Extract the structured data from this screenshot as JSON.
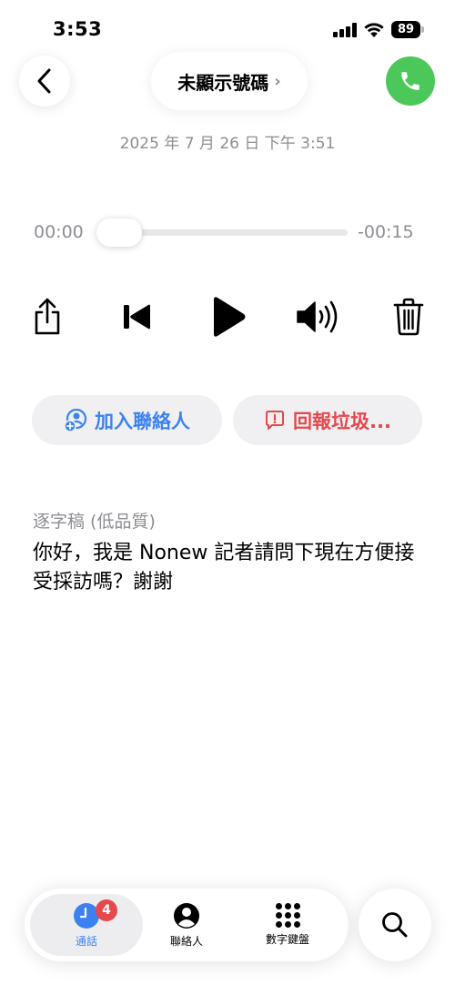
{
  "status_bar": {
    "time": "3:53",
    "battery": "89"
  },
  "header": {
    "caller": "未顯示號碼",
    "caller_chevron": "›",
    "date": "2025 年 7 月 26 日 下午 3:51"
  },
  "player": {
    "elapsed": "00:00",
    "remaining": "-00:15",
    "progress": 0
  },
  "actions": {
    "add_contact": "加入聯絡人",
    "report_spam": "回報垃圾..."
  },
  "transcript": {
    "label": "逐字稿 (低品質)",
    "text": "你好，我是 Nonew 記者請問下現在方便接受採訪嗎？謝謝"
  },
  "tabs": [
    {
      "label": "通話",
      "badge": "4",
      "icon": "clock-icon",
      "active": true
    },
    {
      "label": "聯絡人",
      "icon": "person-circle-icon"
    },
    {
      "label": "數字鍵盤",
      "icon": "keypad-icon"
    }
  ],
  "colors": {
    "accent_blue": "#3b82f0",
    "call_green": "#4cc85a",
    "alert_red": "#e5484d",
    "secondary_text": "#8e8e93"
  }
}
